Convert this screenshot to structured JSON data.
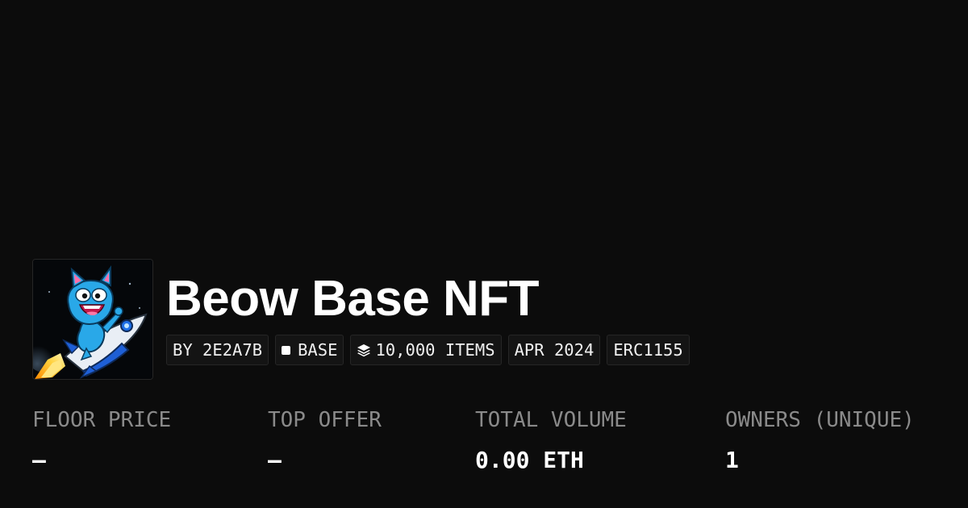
{
  "collection": {
    "title": "Beow Base NFT",
    "image_icon": "blue-cat-riding-rocket-avatar"
  },
  "tags": {
    "creator": "BY 2E2A7B",
    "chain": "BASE",
    "items": "10,000 ITEMS",
    "date": "APR 2024",
    "standard": "ERC1155"
  },
  "icons": {
    "chain": "square-dot-icon",
    "items": "layers-icon"
  },
  "stats": {
    "floor_price": {
      "label": "FLOOR PRICE",
      "value": "–"
    },
    "top_offer": {
      "label": "TOP OFFER",
      "value": "–"
    },
    "total_volume": {
      "label": "TOTAL VOLUME",
      "value": "0.00 ETH"
    },
    "owners": {
      "label": "OWNERS (UNIQUE)",
      "value": "1"
    }
  },
  "colors": {
    "background": "#0c0c0c",
    "tag_background": "#141414",
    "tag_border": "#262626",
    "label_gray": "#8a8a8a",
    "text": "#ffffff"
  }
}
